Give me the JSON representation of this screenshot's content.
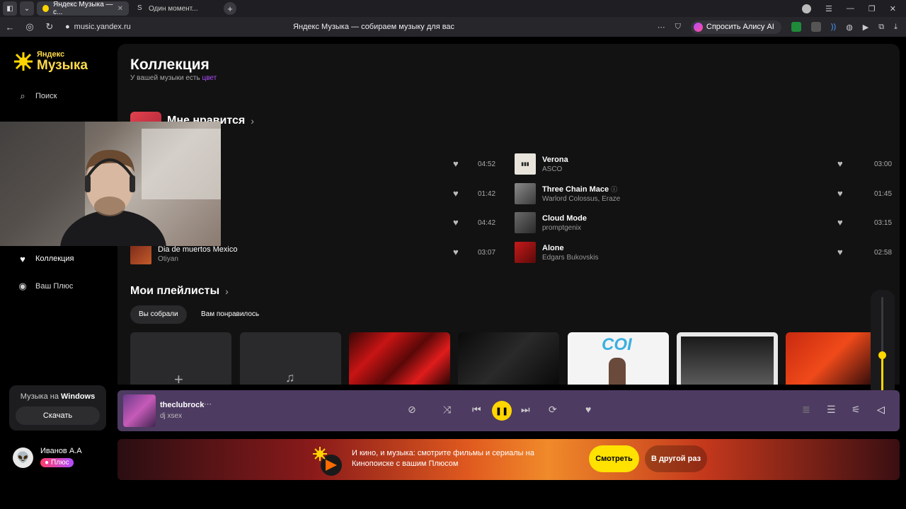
{
  "browser": {
    "tabs": [
      {
        "label": "Яндекс Музыка — с...",
        "active": true
      },
      {
        "label": "Один момент...",
        "active": false
      }
    ],
    "url": "music.yandex.ru",
    "page_title": "Яндекс Музыка — собираем музыку для вас",
    "alisa_label": "Спросить Алису AI"
  },
  "sidebar": {
    "logo_line1": "Яндекс",
    "logo_line2": "Музыка",
    "items": [
      {
        "label": "Поиск",
        "icon": "search-icon"
      },
      {
        "label": "Коллекция",
        "icon": "heart-icon"
      },
      {
        "label": "Ваш Плюс",
        "icon": "plus-icon"
      }
    ],
    "download_card": {
      "prefix": "Музыка на ",
      "platform": "Windows",
      "button": "Скачать"
    },
    "user": {
      "name": "Иванов А.А",
      "badge": "Плюс"
    }
  },
  "main": {
    "title": "Коллекция",
    "subtitle_prefix": "У вашей музыки есть ",
    "subtitle_accent": "цвет",
    "liked_title": "Мне нравится",
    "left_tracks": [
      {
        "duration": "04:52"
      },
      {
        "duration": "01:42"
      },
      {
        "duration": "04:42"
      },
      {
        "title": "Dia de muertos Mexico",
        "artist": "Otiyan",
        "duration": "03:07"
      }
    ],
    "right_tracks": [
      {
        "title": "Verona",
        "artist": "ASCO",
        "duration": "03:00"
      },
      {
        "title": "Three Chain Mace",
        "artist": "Warlord Colossus, Eraze",
        "duration": "01:45"
      },
      {
        "title": "Cloud Mode",
        "artist": "promptgenix",
        "duration": "03:15"
      },
      {
        "title": "Alone",
        "artist": "Edgars Bukovskis",
        "duration": "02:58"
      }
    ],
    "playlists_title": "Мои плейлисты",
    "playlist_tabs": [
      "Вы собрали",
      "Вам понравилось"
    ],
    "coi_label": "COI"
  },
  "player": {
    "title": "theclubrock",
    "artist": "dj xsex",
    "volume": 0.4
  },
  "promo": {
    "text": "И кино, и музыка: смотрите фильмы и сериалы на Кинопоиске с вашим Плюсом",
    "watch": "Смотреть",
    "later": "В другой раз"
  }
}
